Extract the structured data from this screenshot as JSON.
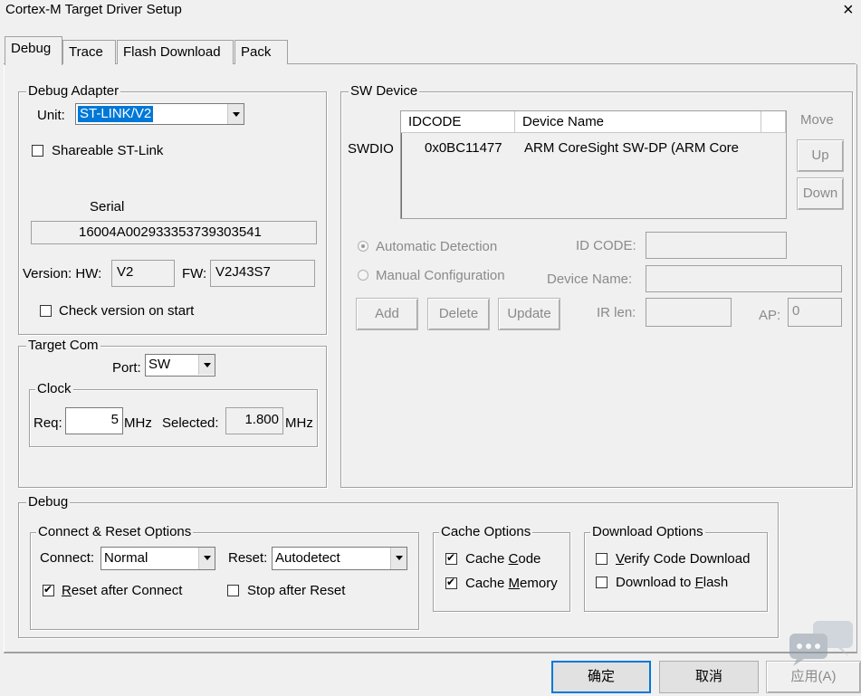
{
  "window": {
    "title": "Cortex-M Target Driver Setup",
    "close_glyph": "×"
  },
  "tabs": [
    {
      "label": "Debug",
      "active": true
    },
    {
      "label": "Trace",
      "active": false
    },
    {
      "label": "Flash Download",
      "active": false
    },
    {
      "label": "Pack",
      "active": false
    }
  ],
  "debug_adapter": {
    "legend": "Debug Adapter",
    "unit_label": "Unit:",
    "unit_value": "ST-LINK/V2",
    "shareable_label": "Shareable ST-Link",
    "shareable_checked": false,
    "serial_label": "Serial",
    "serial_value": "16004A002933353739303541",
    "version_label": "Version: HW:",
    "hw_value": "V2",
    "fw_label": "FW:",
    "fw_value": "V2J43S7",
    "check_version_label": "Check version on start",
    "check_version_checked": false
  },
  "target_com": {
    "legend": "Target Com",
    "port_label": "Port:",
    "port_value": "SW",
    "clock_legend": "Clock",
    "req_label": "Req:",
    "req_value": "5",
    "req_unit": "MHz",
    "selected_label": "Selected:",
    "selected_value": "1.800",
    "selected_unit": "MHz"
  },
  "sw_device": {
    "legend": "SW Device",
    "row_label": "SWDIO",
    "columns": [
      "IDCODE",
      "Device Name"
    ],
    "rows": [
      {
        "idcode": "0x0BC11477",
        "device_name": "ARM CoreSight SW-DP (ARM Core"
      }
    ],
    "move_label": "Move",
    "up_label": "Up",
    "down_label": "Down",
    "auto_detect_label": "Automatic Detection",
    "manual_config_label": "Manual Configuration",
    "id_code_label": "ID CODE:",
    "device_name_label": "Device Name:",
    "ir_len_label": "IR len:",
    "ap_label": "AP:",
    "ap_value": "0",
    "add_label": "Add",
    "delete_label": "Delete",
    "update_label": "Update"
  },
  "debug": {
    "legend": "Debug",
    "connect_reset": {
      "legend": "Connect & Reset Options",
      "connect_label": "Connect:",
      "connect_value": "Normal",
      "reset_label": "Reset:",
      "reset_value": "Autodetect",
      "reset_after_connect": {
        "pre": "",
        "u": "R",
        "post": "eset after Connect",
        "checked": true
      },
      "stop_after_reset_label": "Stop after Reset",
      "stop_after_reset_checked": false
    },
    "cache": {
      "legend": "Cache Options",
      "cache_code": {
        "pre": "Cache ",
        "u": "C",
        "post": "ode",
        "checked": true
      },
      "cache_memory": {
        "pre": "Cache ",
        "u": "M",
        "post": "emory",
        "checked": true
      }
    },
    "download": {
      "legend": "Download Options",
      "verify": {
        "pre": "",
        "u": "V",
        "post": "erify Code Download",
        "checked": false
      },
      "to_flash": {
        "pre": "Download to ",
        "u": "F",
        "post": "lash",
        "checked": false
      }
    }
  },
  "footer": {
    "ok_label": "确定",
    "cancel_label": "取消",
    "apply_label": "应用(A)"
  }
}
